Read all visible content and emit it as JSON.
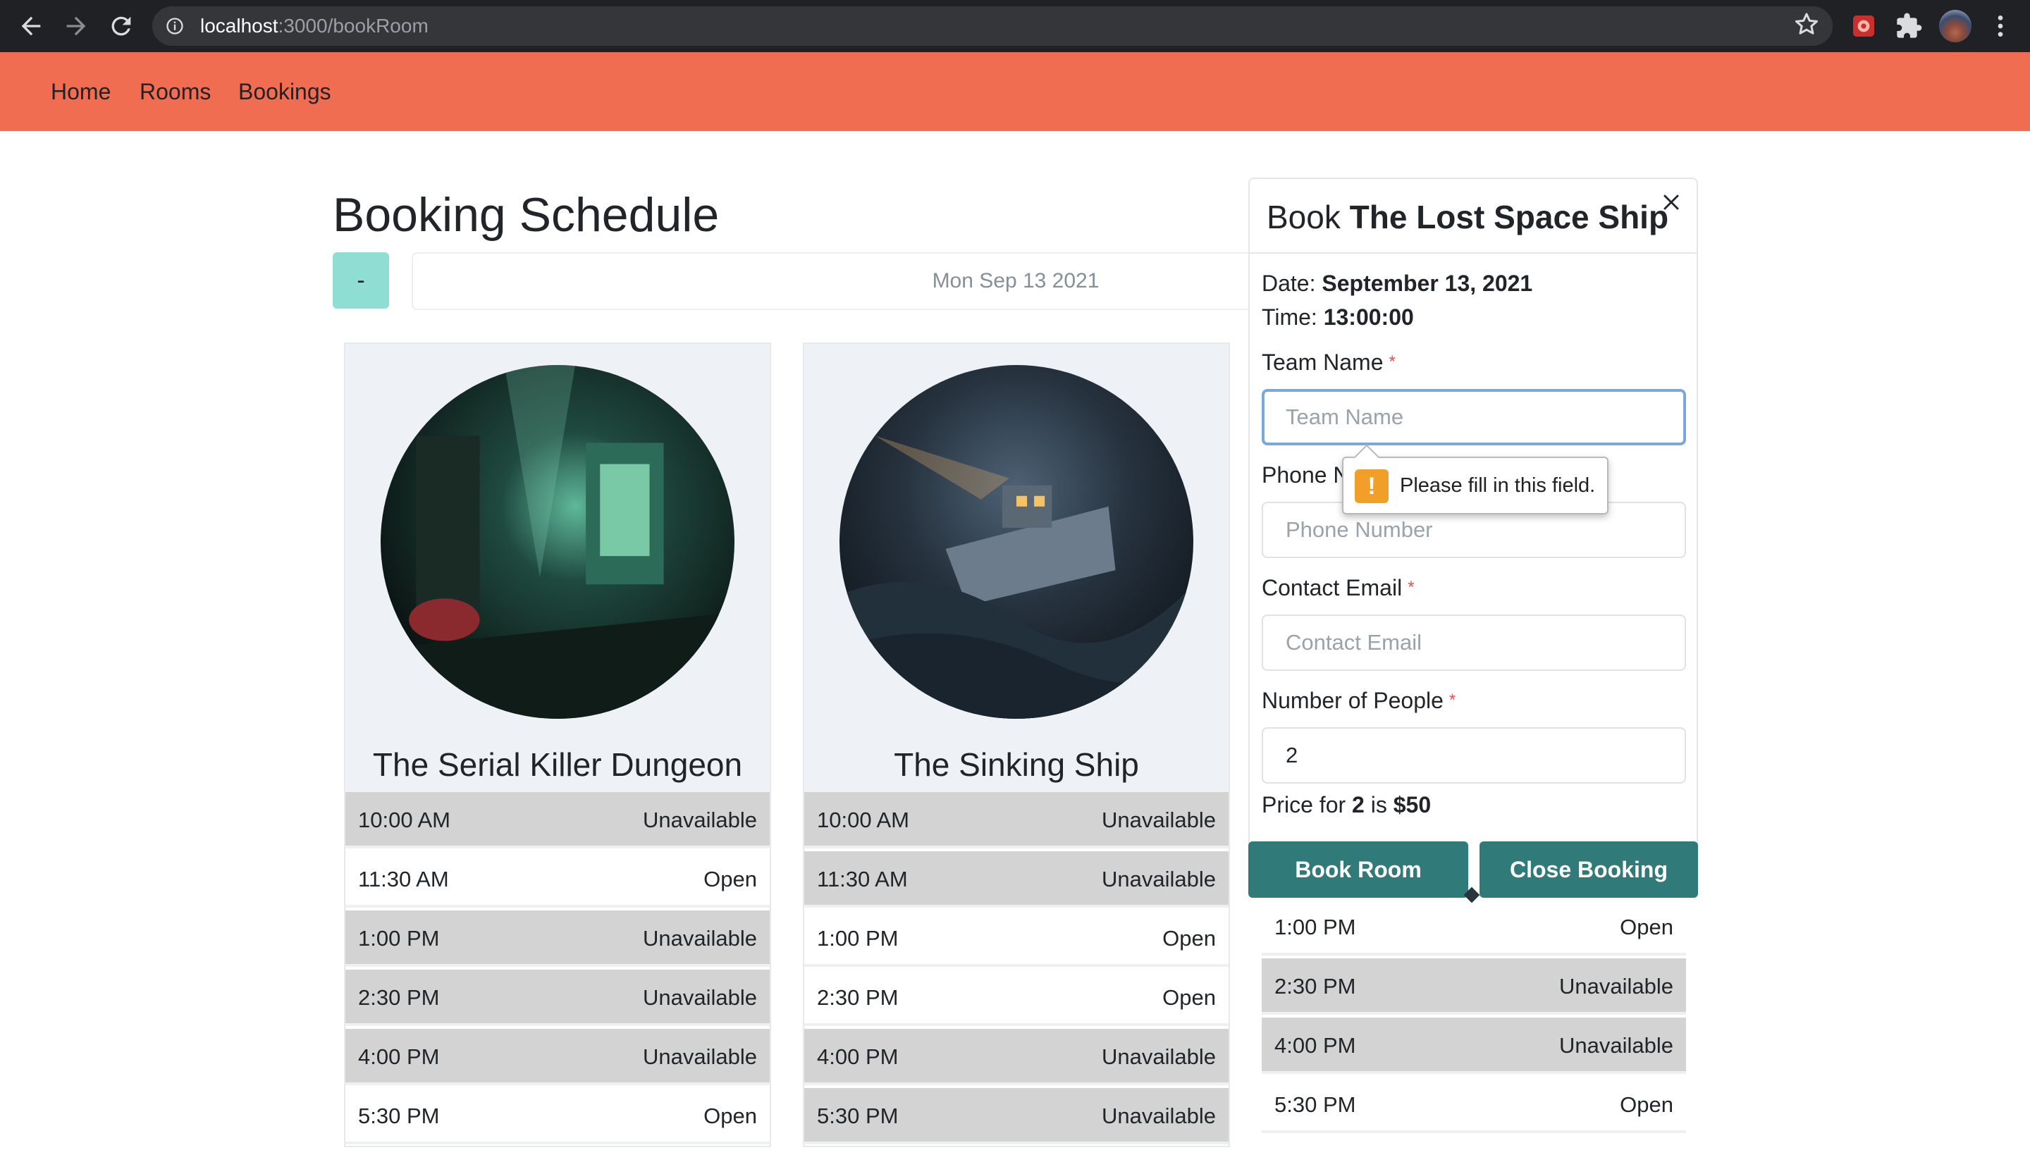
{
  "browser": {
    "url_host": "localhost",
    "url_rest": ":3000/bookRoom"
  },
  "nav": {
    "home": "Home",
    "rooms": "Rooms",
    "bookings": "Bookings"
  },
  "page": {
    "title": "Booking Schedule",
    "prev_button": "-",
    "date": "Mon Sep 13 2021"
  },
  "rooms": [
    {
      "name": "The Serial Killer Dungeon",
      "slots": [
        {
          "time": "10:00 AM",
          "status": "Unavailable"
        },
        {
          "time": "11:30 AM",
          "status": "Open"
        },
        {
          "time": "1:00 PM",
          "status": "Unavailable"
        },
        {
          "time": "2:30 PM",
          "status": "Unavailable"
        },
        {
          "time": "4:00 PM",
          "status": "Unavailable"
        },
        {
          "time": "5:30 PM",
          "status": "Open"
        }
      ]
    },
    {
      "name": "The Sinking Ship",
      "slots": [
        {
          "time": "10:00 AM",
          "status": "Unavailable"
        },
        {
          "time": "11:30 AM",
          "status": "Unavailable"
        },
        {
          "time": "1:00 PM",
          "status": "Open"
        },
        {
          "time": "2:30 PM",
          "status": "Open"
        },
        {
          "time": "4:00 PM",
          "status": "Unavailable"
        },
        {
          "time": "5:30 PM",
          "status": "Unavailable"
        }
      ]
    },
    {
      "name": "The Lost Space Ship",
      "slots": [
        {
          "time": "1:00 PM",
          "status": "Open"
        },
        {
          "time": "2:30 PM",
          "status": "Unavailable"
        },
        {
          "time": "4:00 PM",
          "status": "Unavailable"
        },
        {
          "time": "5:30 PM",
          "status": "Open"
        }
      ]
    }
  ],
  "modal": {
    "title_prefix": "Book",
    "room_name": "The Lost Space Ship",
    "date_label": "Date:",
    "date_value": "September 13, 2021",
    "time_label": "Time:",
    "time_value": "13:00:00",
    "team_name_label": "Team Name",
    "team_name_placeholder": "Team Name",
    "phone_label": "Phone N",
    "phone_placeholder": "Phone Number",
    "email_label": "Contact Email",
    "email_placeholder": "Contact Email",
    "people_label": "Number of People",
    "people_value": "2",
    "required_mark": "*",
    "price_prefix": "Price for",
    "price_count": "2",
    "price_is": "is",
    "price_value": "$50",
    "book_button": "Book Room",
    "close_button": "Close Booking"
  },
  "tooltip": {
    "message": "Please fill in this field.",
    "icon_text": "!"
  }
}
